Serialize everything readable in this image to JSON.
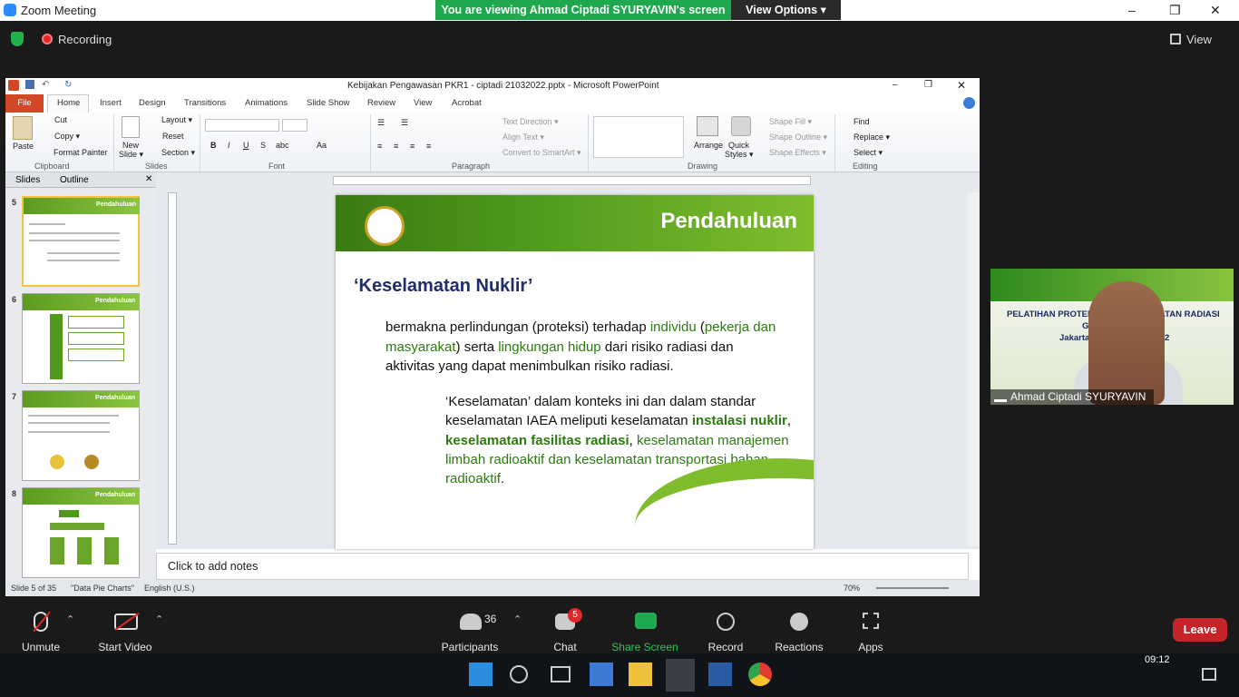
{
  "zoom": {
    "window_title": "Zoom Meeting",
    "banner_text": "You are viewing Ahmad Ciptadi SYURYAVIN's screen",
    "view_options": "View Options ▾",
    "recording": "Recording",
    "view": "View",
    "win_min": "–",
    "win_max": "❐",
    "win_close": "✕"
  },
  "ppt": {
    "title": "Kebijakan Pengawasan PKR1 - ciptadi 21032022.pptx - Microsoft PowerPoint",
    "tabs": [
      "File",
      "Home",
      "Insert",
      "Design",
      "Transitions",
      "Animations",
      "Slide Show",
      "Review",
      "View",
      "Acrobat"
    ],
    "clipboard": {
      "paste": "Paste",
      "cut": "Cut",
      "copy": "Copy ▾",
      "format_painter": "Format Painter",
      "group": "Clipboard"
    },
    "slides_group": {
      "new_slide": "New",
      "new_slide2": "Slide ▾",
      "layout": "Layout ▾",
      "reset": "Reset",
      "section": "Section ▾",
      "group": "Slides"
    },
    "font_group": "Font",
    "paragraph": {
      "text_direction": "Text Direction ▾",
      "align_text": "Align Text ▾",
      "convert": "Convert to SmartArt ▾",
      "group": "Paragraph"
    },
    "drawing": {
      "arrange": "Arrange",
      "quick1": "Quick",
      "quick2": "Styles ▾",
      "shape_fill": "Shape Fill ▾",
      "shape_outline": "Shape Outline ▾",
      "shape_effects": "Shape Effects ▾",
      "group": "Drawing"
    },
    "editing": {
      "find": "Find",
      "replace": "Replace ▾",
      "select": "Select ▾",
      "group": "Editing"
    },
    "pane_tabs": {
      "slides": "Slides",
      "outline": "Outline"
    },
    "thumbs": [
      {
        "num": "5",
        "title": "Pendahuluan"
      },
      {
        "num": "6",
        "title": "Pendahuluan"
      },
      {
        "num": "7",
        "title": "Pendahuluan"
      },
      {
        "num": "8",
        "title": "Pendahuluan"
      }
    ],
    "slide": {
      "header": "Pendahuluan",
      "heading": "‘Keselamatan Nuklir’",
      "p1_a": "bermakna  perlindungan   (proteksi) terhadap ",
      "p1_b": "individu",
      "p1_c": "  (",
      "p1_d": "pekerja dan masyarakat",
      "p1_e": ") serta ",
      "p1_f": "lingkungan  hidup",
      "p1_g": " dari risiko radiasi dan aktivitas yang  dapat menimbulkan  risiko radiasi.",
      "p2_a": "‘Keselamatan’ dalam konteks ini dan dalam  standar keselamatan IAEA meliputi keselamatan  ",
      "p2_b": "instalasi nuklir",
      "p2_c": ",  ",
      "p2_d": "keselamatan fasilitas radiasi",
      "p2_e": ", ",
      "p2_f": "keselamatan manajemen  limbah radioaktif dan keselamatan transportasi bahan radioaktif",
      "p2_g": "."
    },
    "notes": "Click to add notes",
    "status": {
      "slide": "Slide 5 of 35",
      "theme": "\"Data Pie Charts\"",
      "lang": "English (U.S.)",
      "zoom": "70%"
    }
  },
  "video": {
    "line1a": "PELATIHAN PROTEKS",
    "line1b": "ATAN RADIASI",
    "line2": "G",
    "line3a": "Jakarta",
    "line3b": "2",
    "name": "Ahmad Ciptadi SYURYAVIN"
  },
  "toolbar": {
    "unmute": "Unmute",
    "start_video": "Start Video",
    "participants": "Participants",
    "participants_count": "36",
    "chat": "Chat",
    "chat_badge": "5",
    "share": "Share Screen",
    "record": "Record",
    "reactions": "Reactions",
    "apps": "Apps",
    "leave": "Leave"
  },
  "taskbar": {
    "time": "09:12"
  },
  "colors": {
    "zoom_green": "#1fa84e",
    "leave_red": "#c7242a",
    "slide_green": "#4e9a1d",
    "heading_navy": "#1f2d6b",
    "ppt_file": "#d24726"
  }
}
